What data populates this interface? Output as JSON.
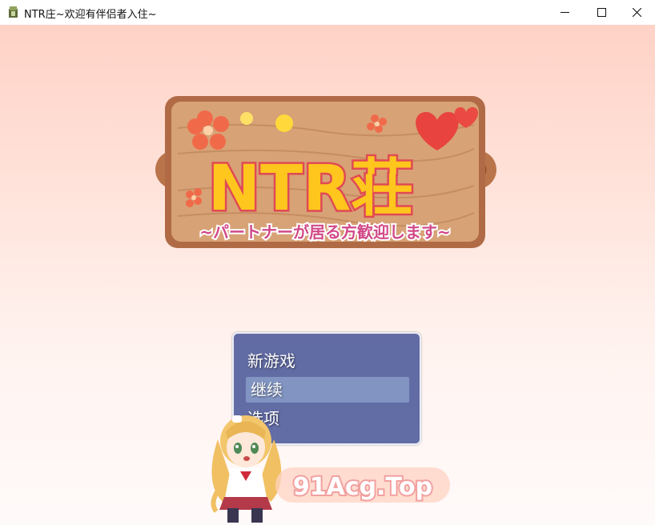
{
  "window": {
    "title": "NTR庄~欢迎有伴侣者入住~",
    "controls": [
      "minimize",
      "maximize",
      "close"
    ]
  },
  "logo": {
    "main_text": "NTR荘",
    "subtitle": "~パートナーが居る方歓迎します~"
  },
  "menu": {
    "items": [
      {
        "label": "新游戏",
        "selected": false
      },
      {
        "label": "继续",
        "selected": true
      },
      {
        "label": "选项",
        "selected": false
      }
    ]
  },
  "watermark": {
    "text": "91Acg.Top"
  },
  "colors": {
    "menu_bg": "#4654a0",
    "logo_text": "#ffc61d",
    "logo_outline": "#e04a54",
    "subtitle_text": "#d14a88",
    "wood": "#c98b60"
  },
  "icons": [
    "app-icon",
    "minimize-icon",
    "maximize-icon",
    "close-icon",
    "flower-icon",
    "heart-icon"
  ]
}
